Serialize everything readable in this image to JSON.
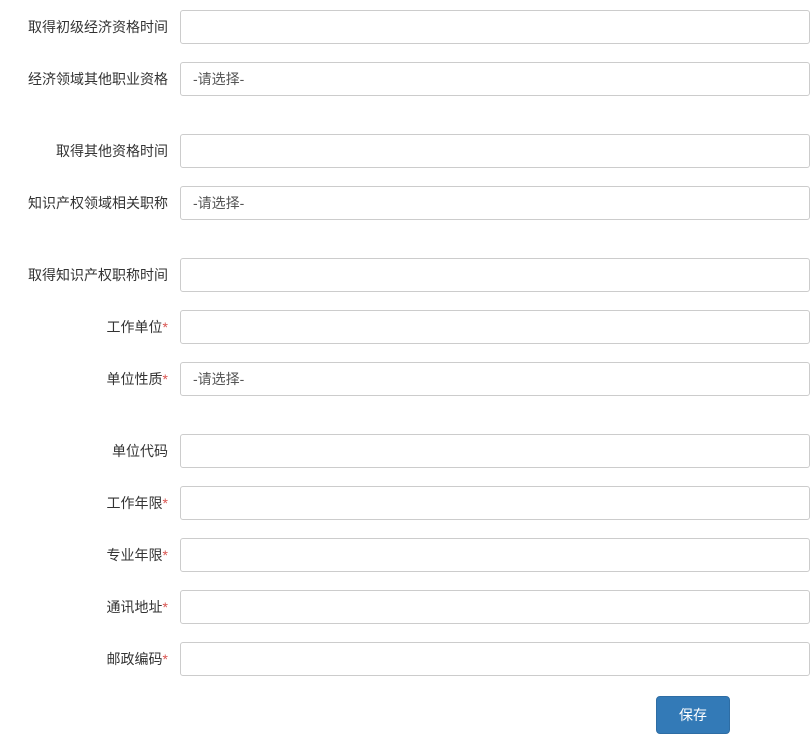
{
  "fields": {
    "obtain_primary_economics_time": {
      "label": "取得初级经济资格时间",
      "value": ""
    },
    "other_economics_qualification": {
      "label": "经济领域其他职业资格",
      "value": "-请选择-"
    },
    "obtain_other_qualification_time": {
      "label": "取得其他资格时间",
      "value": ""
    },
    "ip_related_title": {
      "label": "知识产权领域相关职称",
      "value": "-请选择-"
    },
    "obtain_ip_title_time": {
      "label": "取得知识产权职称时间",
      "value": ""
    },
    "work_unit": {
      "label": "工作单位",
      "value": ""
    },
    "unit_nature": {
      "label": "单位性质",
      "value": "-请选择-"
    },
    "unit_code": {
      "label": "单位代码",
      "value": ""
    },
    "work_years": {
      "label": "工作年限",
      "value": ""
    },
    "major_years": {
      "label": "专业年限",
      "value": ""
    },
    "mailing_address": {
      "label": "通讯地址",
      "value": ""
    },
    "postal_code": {
      "label": "邮政编码",
      "value": ""
    }
  },
  "buttons": {
    "save": "保存"
  },
  "required_marker": "*"
}
